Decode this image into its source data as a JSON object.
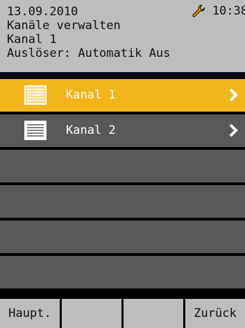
{
  "header": {
    "date": "13.09.2010",
    "time": "10:38",
    "title": "Kanäle verwalten",
    "channel": "Kanal 1",
    "trigger": "Auslöser: Automatik Aus"
  },
  "list": {
    "items": [
      {
        "label": "Kanal 1",
        "selected": true,
        "icon": "channel-list-icon"
      },
      {
        "label": "Kanal 2",
        "selected": false,
        "icon": "channel-list-icon"
      },
      {
        "label": ""
      },
      {
        "label": ""
      },
      {
        "label": ""
      },
      {
        "label": ""
      }
    ]
  },
  "footer": {
    "buttons": [
      "Haupt.",
      "",
      "",
      "Zurück"
    ]
  },
  "colors": {
    "accent": "#f2b51c",
    "header_bg": "#bdbdbd",
    "row_bg": "#595959"
  }
}
